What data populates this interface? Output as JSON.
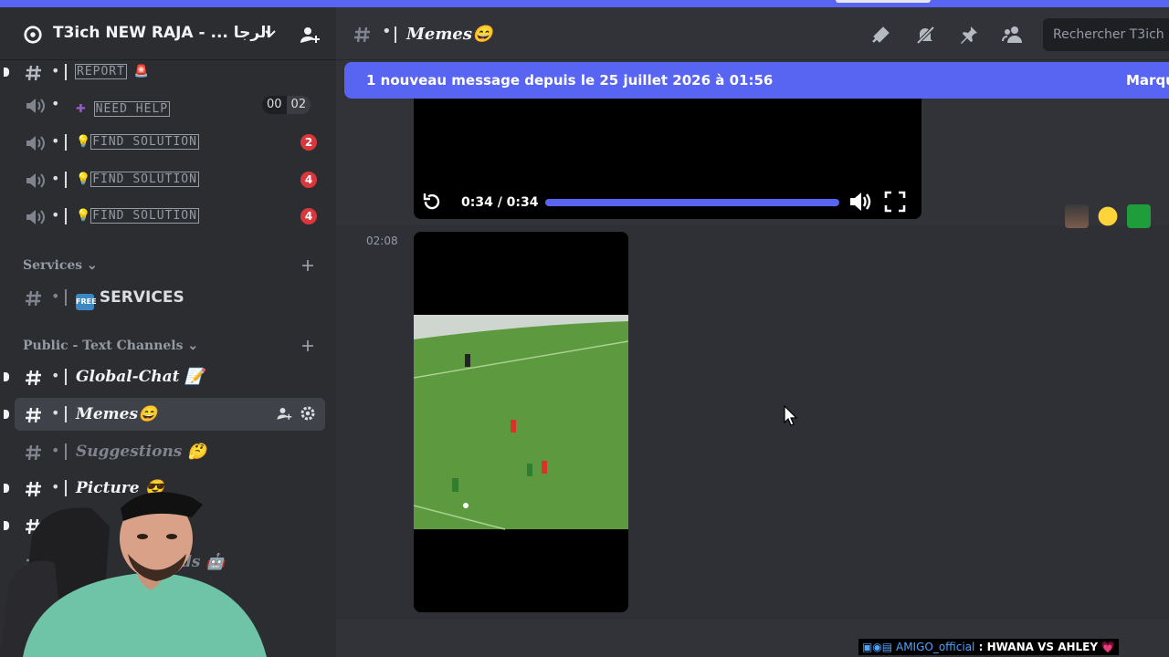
{
  "server": {
    "name": "T3ich NEW RAJA - ... الرجا"
  },
  "channels_top": [
    {
      "label": "REPORT",
      "emoji": "🚨"
    },
    {
      "label": "NEED HELP",
      "voice_counts": [
        "00",
        "02"
      ]
    },
    {
      "label": "FIND SOLUTION",
      "badge": "2"
    },
    {
      "label": "FIND SOLUTION",
      "badge": "4"
    },
    {
      "label": "FIND SOLUTION",
      "badge": "4"
    }
  ],
  "categories": [
    {
      "label": "Services"
    },
    {
      "label": "Public - Text Channels"
    }
  ],
  "services_channel": {
    "label": "SERVICES"
  },
  "public_channels": [
    {
      "label": "Global-Chat",
      "emoji": "📝"
    },
    {
      "label": "Memes",
      "emoji": "😄"
    },
    {
      "label": "Suggestions",
      "emoji": "🤔"
    },
    {
      "label": "Picture",
      "emoji": "😎"
    },
    {
      "label": "ds",
      "emoji": "🤖"
    }
  ],
  "header": {
    "title": "Memes😄",
    "search_placeholder": "Rechercher T3ich"
  },
  "new_messages_bar": {
    "text": "1 nouveau message depuis le 25 juillet 2026 à 01:56",
    "action": "Marqu"
  },
  "video_player": {
    "time": "0:34 / 0:34",
    "progress": 1.0
  },
  "message": {
    "timestamp": "02:08"
  },
  "stream_ticker": {
    "user": "AMIGO_official",
    "separator": " : ",
    "text": "HWANA VS AHLEY",
    "heart": "💗"
  },
  "colors": {
    "accent": "#5865f2",
    "sidebar": "#2b2d31",
    "chat": "#313338",
    "badge": "#da373c"
  }
}
